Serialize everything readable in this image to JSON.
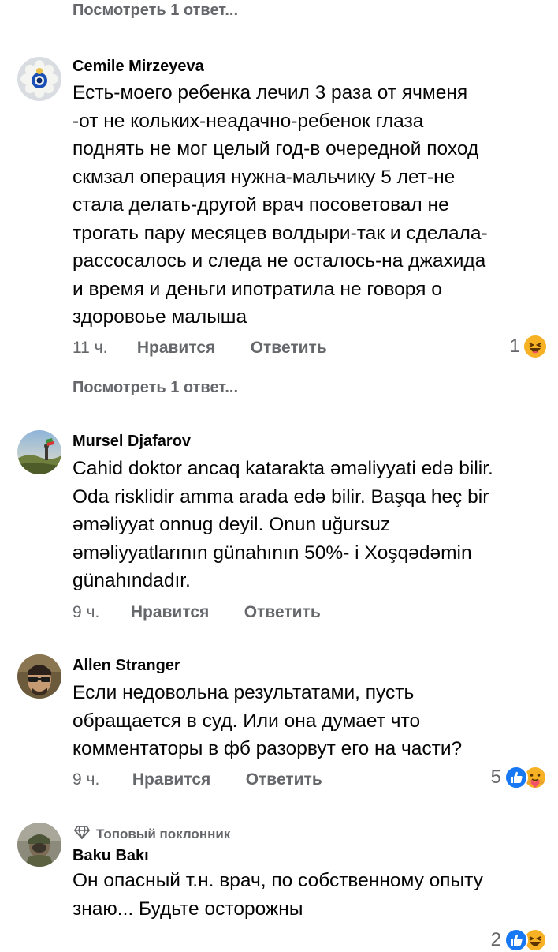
{
  "top_partial": {
    "view_replies": "Посмотреть 1 ответ..."
  },
  "comments": [
    {
      "author": "Cemile Mirzeyeva",
      "text_lines": [
        "Есть-моего ребенка лечил 3 раза от ячменя",
        "-от не кольких-неадачно-ребенок глаза",
        "поднять не мог целый год-в очередной поход",
        "скмзал операция нужна-мальчику 5 лет-не",
        "стала делать-другой врач посоветовал не",
        "трогать пару месяцев волдыри-так и сделала-",
        "рассосалось и следа не осталось-на джахида",
        "и время и деньги ипотратила не говоря о",
        "здоровоье малыша"
      ],
      "time": "11 ч.",
      "like_label": "Нравится",
      "reply_label": "Ответить",
      "reaction_count": "1",
      "reaction_icons": [
        "haha-emoji-icon"
      ],
      "view_replies": "Посмотреть 1 ответ..."
    },
    {
      "author": "Mursel Djafarov",
      "text_lines": [
        "Cahid doktor ancaq katarakta əməliyyati edə bilir.",
        "Oda risklidir amma arada edə bilir. Başqa heç bir",
        "əməliyyat onnug deyil. Onun uğursuz",
        "əməliyyatlarının günahının 50%- i Xoşqədəmin",
        "günahındadır."
      ],
      "time": "9 ч.",
      "like_label": "Нравится",
      "reply_label": "Ответить"
    },
    {
      "author": "Allen Stranger",
      "text_lines": [
        "Если недовольна результатами, пусть",
        "обращается в суд. Или она думает что",
        "комментаторы в фб разорвут его на части?"
      ],
      "time": "9 ч.",
      "like_label": "Нравится",
      "reply_label": "Ответить",
      "reaction_count": "5",
      "reaction_icons": [
        "like-icon",
        "care-emoji-icon"
      ]
    },
    {
      "badge": "Топовый поклонник",
      "author": "Baku Bakı",
      "text_lines": [
        "Он опасный т.н. врач, по собственному опыту",
        "знаю... Будьте осторожны"
      ],
      "reaction_count": "2"
    }
  ],
  "colors": {
    "text": "#050505",
    "secondary": "#65676b",
    "like_blue": "#1877f2",
    "haha_yellow": "#f7b125"
  }
}
